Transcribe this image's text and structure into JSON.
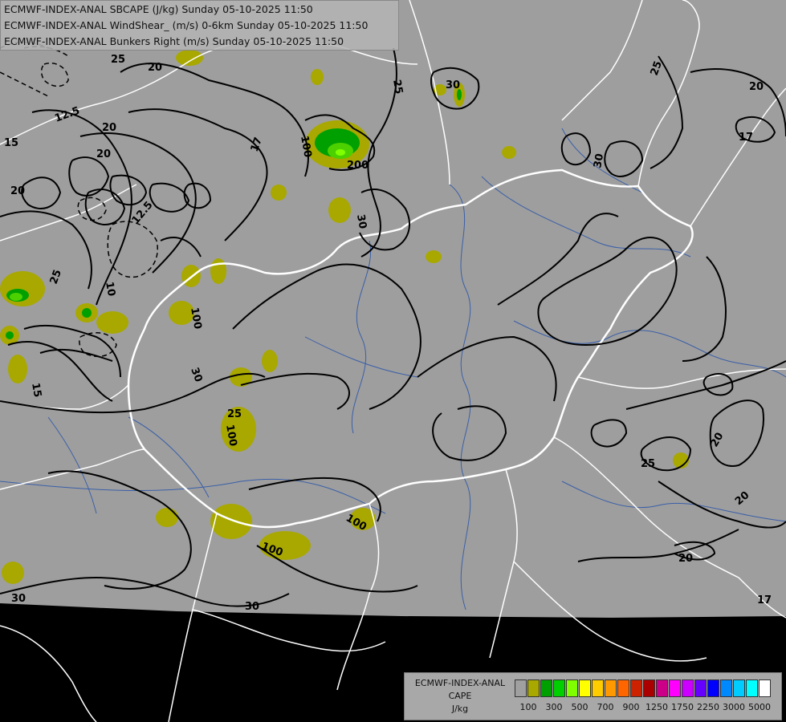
{
  "header": {
    "line1": "ECMWF-INDEX-ANAL SBCAPE (J/kg) Sunday 05-10-2025 11:50",
    "line2": "ECMWF-INDEX-ANAL WindShear_ (m/s) 0-6km Sunday 05-10-2025 11:50",
    "line3": "ECMWF-INDEX-ANAL Bunkers Right (m/s) Sunday 05-10-2025 11:50"
  },
  "legend": {
    "title_line1": "ECMWF-INDEX-ANAL",
    "title_line2": "CAPE",
    "title_line3": "J/kg",
    "swatches": [
      "#a0a0a0",
      "#a8a800",
      "#00a000",
      "#00d000",
      "#80ff00",
      "#ffff00",
      "#ffcc00",
      "#ff9900",
      "#ff6600",
      "#cc2200",
      "#aa0000",
      "#cc0088",
      "#ff00ff",
      "#cc00ff",
      "#6600ff",
      "#0000ff",
      "#0088ff",
      "#00ccff",
      "#00ffff",
      "#ffffff"
    ],
    "ticks": [
      "100",
      "300",
      "500",
      "700",
      "900",
      "1250",
      "1750",
      "2250",
      "3000",
      "5000"
    ]
  },
  "contour_labels": {
    "l1": "20",
    "l2": "25",
    "l3": "20",
    "l4": "17",
    "l5": "15",
    "l6": "12.5",
    "l7": "20",
    "l8": "25",
    "l9": "30",
    "l10": "10",
    "l11": "15",
    "l12": "100",
    "l13": "200",
    "l14": "30",
    "l15": "30",
    "l16": "25",
    "l17": "100",
    "l18": "25",
    "l19": "100",
    "l20": "30",
    "l21": "100",
    "l22": "17",
    "l23": "20",
    "l24": "25",
    "l25": "20",
    "l26": "20",
    "l27": "20",
    "l28": "30",
    "l29": "30",
    "l30": "17",
    "l31": "100",
    "l32": "25",
    "l33": "12.5",
    "l34": "20"
  },
  "colors": {
    "background": "#000000",
    "data_area": "#9e9e9e",
    "cape_100": "#a8a800",
    "cape_300": "#00a000",
    "cape_500": "#00d000",
    "cape_700": "#80ff00",
    "border": "#ffffff",
    "river": "#3a5fa8",
    "contour": "#000000"
  }
}
